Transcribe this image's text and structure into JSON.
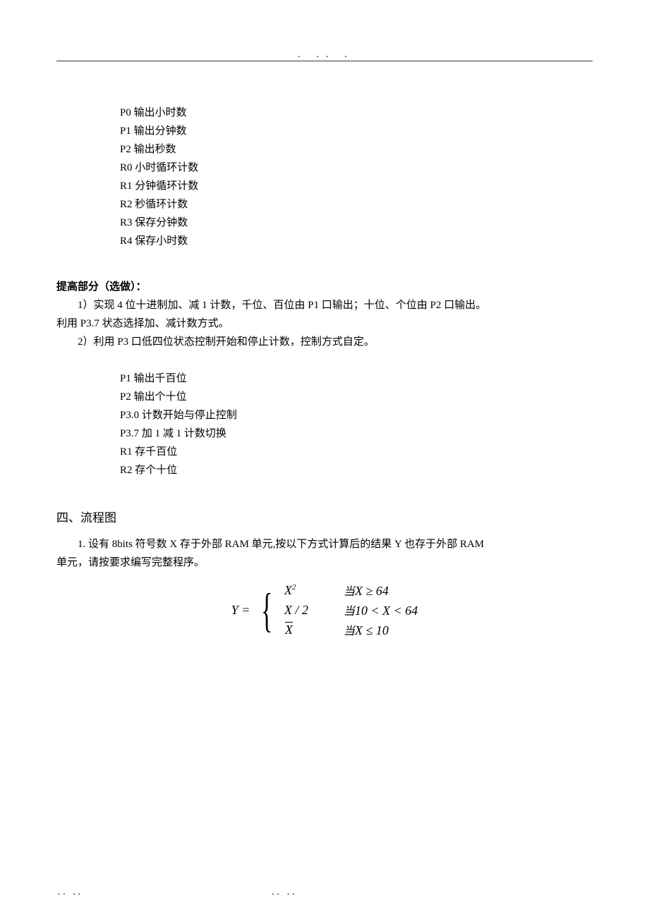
{
  "header": {
    "dots": ".                 ..           ."
  },
  "block1": {
    "l0": "P0 输出小时数",
    "l1": "P1 输出分钟数",
    "l2": "P2 输出秒数",
    "l3": "R0 小时循环计数",
    "l4": "R1 分钟循环计数",
    "l5": "R2 秒循环计数",
    "l6": "R3 保存分钟数",
    "l7": "R4 保存小时数"
  },
  "enhance": {
    "title": "提高部分（选做）：",
    "p1a": "1）实现 4 位十进制加、减 1 计数，千位、百位由 P1 口输出；十位、个位由 P2 口输出。",
    "p1b": "利用 P3.7 状态选择加、减计数方式。",
    "p2": "2）利用 P3 口低四位状态控制开始和停止计数，控制方式自定。"
  },
  "block2": {
    "l0": "P1 输出千百位",
    "l1": "P2 输出个十位",
    "l2": "P3.0 计数开始与停止控制",
    "l3": "P3.7 加 1 减 1 计数切换",
    "l4": "R1 存千百位",
    "l5": "R2 存个十位"
  },
  "section4": {
    "title": "四、流程图",
    "p1": "1. 设有 8bits 符号数 X 存于外部 RAM 单元,按以下方式计算后的结果 Y 也存于外部 RAM",
    "p1b": "单元，请按要求编写完整程序。"
  },
  "formula": {
    "lhs": "Y =",
    "case1_expr": "X",
    "case1_sup": "2",
    "case1_cond_cj": "当",
    "case1_cond": "X ≥ 64",
    "case2_expr": "X / 2",
    "case2_cond_cj": "当",
    "case2_cond": "10 < X < 64",
    "case3_expr": "X",
    "case3_cond_cj": "当",
    "case3_cond": "X ≤ 10"
  },
  "footer": {
    "left": "..        ..",
    "right": "..        .."
  }
}
